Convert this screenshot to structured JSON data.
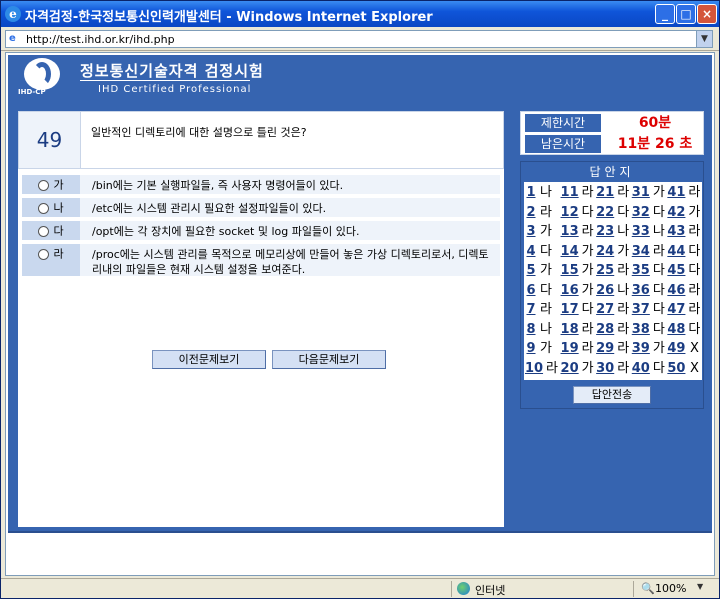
{
  "window": {
    "title": "자격검정-한국정보통신인력개발센터 - Windows Internet Explorer"
  },
  "address": {
    "url": "http://test.ihd.or.kr/ihd.php"
  },
  "header": {
    "title_kor": "정보통신기술자격 검정시험",
    "title_eng": "IHD Certified Professional",
    "logo_text": "IHD-CP"
  },
  "question": {
    "number": "49",
    "text": "일반적인 디렉토리에 대한 설명으로 틀린 것은?",
    "options": [
      {
        "label": "가",
        "text": "/bin에는 기본 실행파일들, 즉 사용자 명령어들이 있다."
      },
      {
        "label": "나",
        "text": "/etc에는 시스템 관리시 필요한 설정파일들이 있다."
      },
      {
        "label": "다",
        "text": "/opt에는 각 장치에 필요한 socket 및 log 파일들이 있다."
      },
      {
        "label": "라",
        "text": "/proc에는 시스템 관리를 목적으로 메모리상에 만들어 놓은 가상 디렉토리로서, 디렉토리내의 파일들은 현재 시스템 설정을 보여준다."
      }
    ]
  },
  "nav": {
    "prev_label": "이전문제보기",
    "next_label": "다음문제보기"
  },
  "timer": {
    "limit_label": "제한시간",
    "limit_value": "60분",
    "remain_label": "남은시간",
    "remain_value": "11분 26 초"
  },
  "answers": {
    "title": "답안지",
    "submit_label": "답안전송",
    "items": [
      {
        "n": "1",
        "a": "나"
      },
      {
        "n": "2",
        "a": "라"
      },
      {
        "n": "3",
        "a": "가"
      },
      {
        "n": "4",
        "a": "다"
      },
      {
        "n": "5",
        "a": "가"
      },
      {
        "n": "6",
        "a": "다"
      },
      {
        "n": "7",
        "a": "라"
      },
      {
        "n": "8",
        "a": "나"
      },
      {
        "n": "9",
        "a": "가"
      },
      {
        "n": "10",
        "a": "라"
      },
      {
        "n": "11",
        "a": "라"
      },
      {
        "n": "12",
        "a": "다"
      },
      {
        "n": "13",
        "a": "라"
      },
      {
        "n": "14",
        "a": "가"
      },
      {
        "n": "15",
        "a": "가"
      },
      {
        "n": "16",
        "a": "가"
      },
      {
        "n": "17",
        "a": "다"
      },
      {
        "n": "18",
        "a": "라"
      },
      {
        "n": "19",
        "a": "라"
      },
      {
        "n": "20",
        "a": "가"
      },
      {
        "n": "21",
        "a": "라"
      },
      {
        "n": "22",
        "a": "다"
      },
      {
        "n": "23",
        "a": "나"
      },
      {
        "n": "24",
        "a": "가"
      },
      {
        "n": "25",
        "a": "라"
      },
      {
        "n": "26",
        "a": "나"
      },
      {
        "n": "27",
        "a": "라"
      },
      {
        "n": "28",
        "a": "라"
      },
      {
        "n": "29",
        "a": "라"
      },
      {
        "n": "30",
        "a": "라"
      },
      {
        "n": "31",
        "a": "가"
      },
      {
        "n": "32",
        "a": "다"
      },
      {
        "n": "33",
        "a": "나"
      },
      {
        "n": "34",
        "a": "라"
      },
      {
        "n": "35",
        "a": "다"
      },
      {
        "n": "36",
        "a": "다"
      },
      {
        "n": "37",
        "a": "다"
      },
      {
        "n": "38",
        "a": "다"
      },
      {
        "n": "39",
        "a": "가"
      },
      {
        "n": "40",
        "a": "다"
      },
      {
        "n": "41",
        "a": "라"
      },
      {
        "n": "42",
        "a": "가"
      },
      {
        "n": "43",
        "a": "라"
      },
      {
        "n": "44",
        "a": "다"
      },
      {
        "n": "45",
        "a": "다"
      },
      {
        "n": "46",
        "a": "라"
      },
      {
        "n": "47",
        "a": "라"
      },
      {
        "n": "48",
        "a": "다"
      },
      {
        "n": "49",
        "a": "X"
      },
      {
        "n": "50",
        "a": "X"
      }
    ]
  },
  "status": {
    "zone": "인터넷",
    "zoom": "100%"
  },
  "colors": {
    "frame_blue": "#3664b0",
    "timer_red": "#dd0000",
    "link_blue": "#1b3c82"
  }
}
